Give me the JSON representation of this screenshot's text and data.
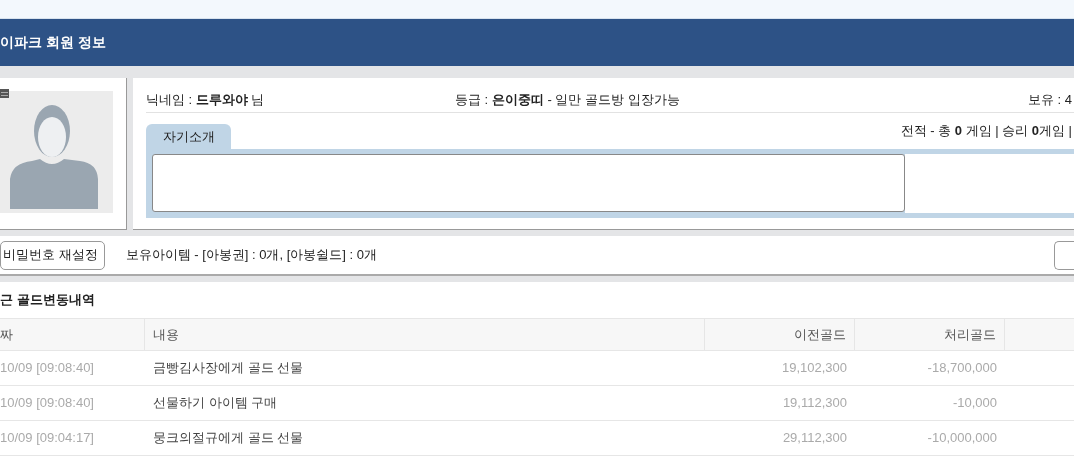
{
  "header": {
    "title": "이파크 회원 정보"
  },
  "profile": {
    "nickname": "닉네임 : **드루와야** 님",
    "grade": "등급 : **은이중띠** - 일만 골드방 입장가능",
    "holding": "보유 : 4",
    "record": "전적 - 총 **0** 게임 | 승리 **0**게임 |",
    "tabs": [
      {
        "label": "자기소개",
        "selected": true
      }
    ]
  },
  "actions": {
    "reset_button": "비밀번호 재설정",
    "items": "보유아이템 - [아봉권] : 0개, [아봉쉴드] : 0개"
  },
  "history": {
    "title": "근 골드변동내역",
    "columns": [
      "짜",
      "내용",
      "이전골드",
      "처리골드"
    ],
    "rows": [
      {
        "date": "10/09 [09:08:40]",
        "content": "금빵김사장에게 골드 선물",
        "before": "19,102,300",
        "change": "-18,700,000"
      },
      {
        "date": "10/09 [09:08:40]",
        "content": "선물하기 아이템 구매",
        "before": "19,112,300",
        "change": "-10,000"
      },
      {
        "date": "10/09 [09:04:17]",
        "content": "뭉크의절규에게 골드 선물",
        "before": "29,112,300",
        "change": "-10,000,000"
      }
    ]
  }
}
